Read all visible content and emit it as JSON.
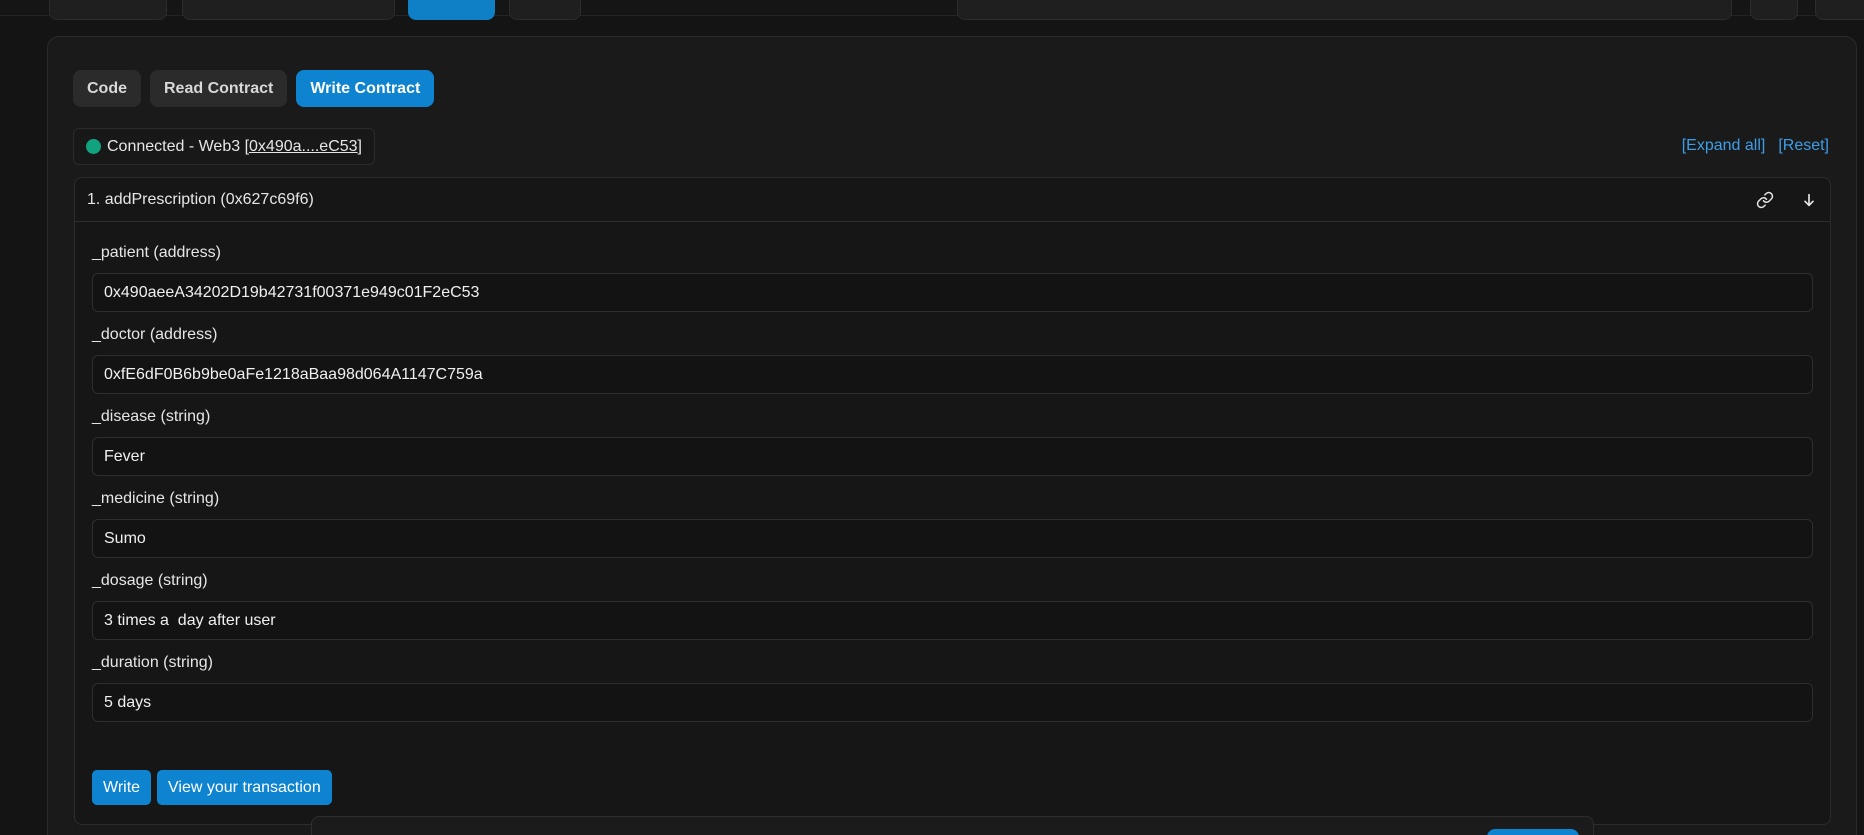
{
  "tabs": [
    {
      "label": "Code",
      "active": false
    },
    {
      "label": "Read Contract",
      "active": false
    },
    {
      "label": "Write Contract",
      "active": true
    }
  ],
  "connection": {
    "status_text": "Connected - Web3 [",
    "address_short": "0x490a....eC53",
    "close_bracket": "]",
    "status_color": "#11a37f"
  },
  "links": {
    "expand_all": "[Expand all]",
    "reset": "[Reset]"
  },
  "function": {
    "title": "1. addPrescription (0x627c69f6)",
    "icons": [
      "link-icon",
      "arrow-down-icon"
    ],
    "inputs": [
      {
        "label": "_patient (address)",
        "value": "0x490aeeA34202D19b42731f00371e949c01F2eC53"
      },
      {
        "label": "_doctor (address)",
        "value": "0xfE6dF0B6b9be0aFe1218aBaa98d064A1147C759a"
      },
      {
        "label": "_disease (string)",
        "value": "Fever"
      },
      {
        "label": "_medicine (string)",
        "value": "Sumo"
      },
      {
        "label": "_dosage (string)",
        "value": "3 times a  day after user"
      },
      {
        "label": "_duration (string)",
        "value": "5 days"
      }
    ],
    "buttons": {
      "write": "Write",
      "view_tx": "View your transaction"
    }
  },
  "colors": {
    "accent": "#0e84d0",
    "link": "#3d9ee8",
    "background": "#141414"
  }
}
